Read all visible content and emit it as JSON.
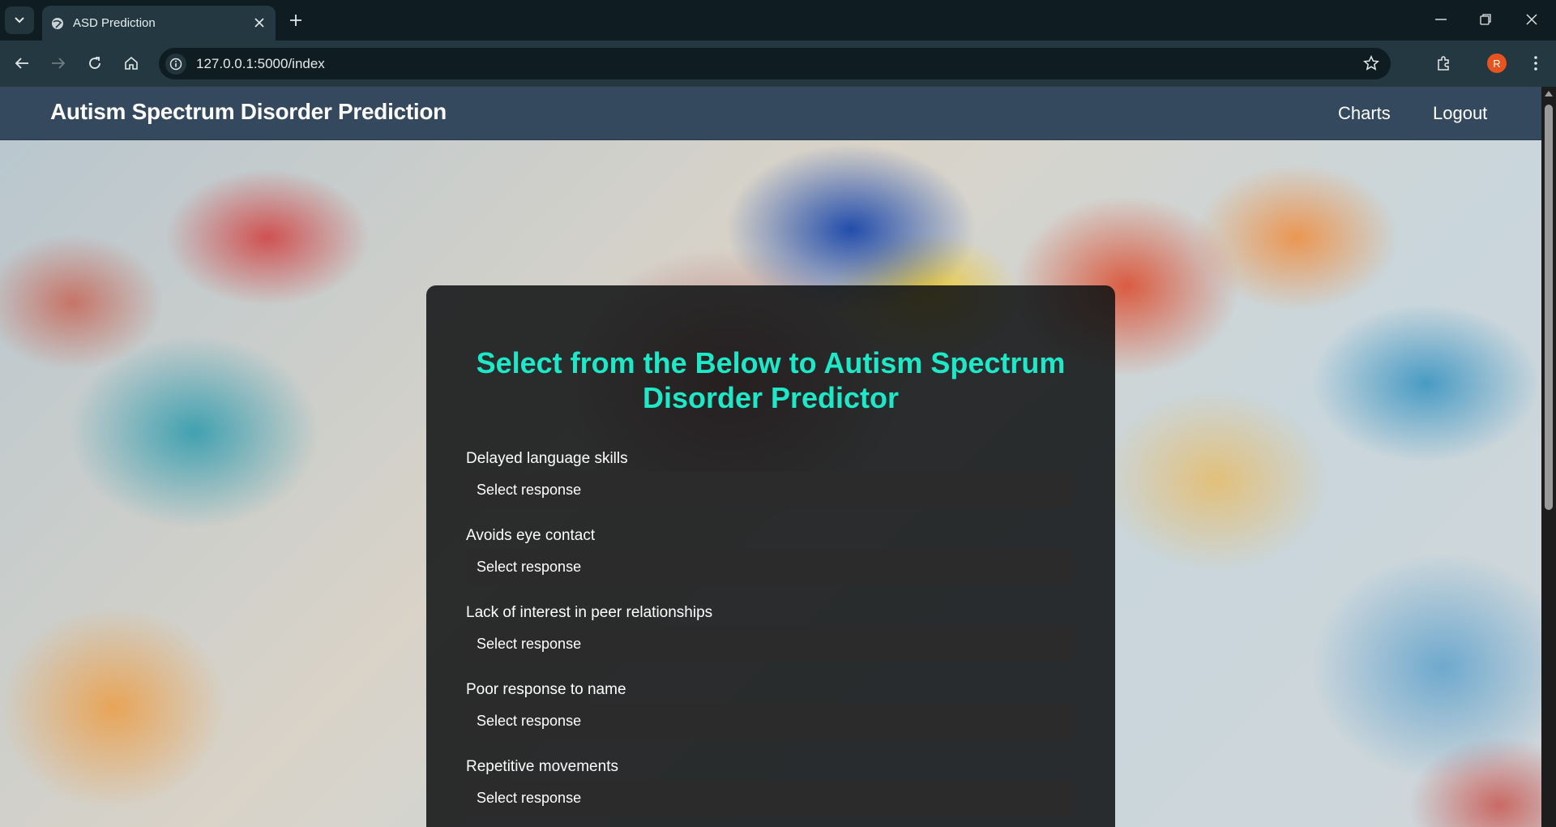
{
  "browser": {
    "tab_title": "ASD Prediction",
    "url": "127.0.0.1:5000/index",
    "profile_initial": "R"
  },
  "navbar": {
    "brand": "Autism Spectrum Disorder Prediction",
    "links": [
      "Charts",
      "Logout"
    ]
  },
  "form": {
    "title": "Select from the Below to Autism Spectrum Disorder Predictor",
    "fields": [
      {
        "label": "Delayed language skills",
        "value": "Select response"
      },
      {
        "label": "Avoids eye contact",
        "value": "Select response"
      },
      {
        "label": "Lack of interest in peer relationships",
        "value": "Select response"
      },
      {
        "label": "Poor response to name",
        "value": "Select response"
      },
      {
        "label": "Repetitive movements",
        "value": "Select response"
      }
    ]
  },
  "colors": {
    "navbar": "#34495e",
    "title_accent": "#1de9c8",
    "card": "#121416",
    "select_bg": "#2b2b2b"
  },
  "icons": [
    "tab-search-icon",
    "globe-icon",
    "close-icon",
    "plus-icon",
    "minimize-icon",
    "restore-icon",
    "window-close-icon",
    "back-icon",
    "forward-icon",
    "reload-icon",
    "home-icon",
    "site-info-icon",
    "star-icon",
    "extensions-icon",
    "menu-dots-icon"
  ]
}
